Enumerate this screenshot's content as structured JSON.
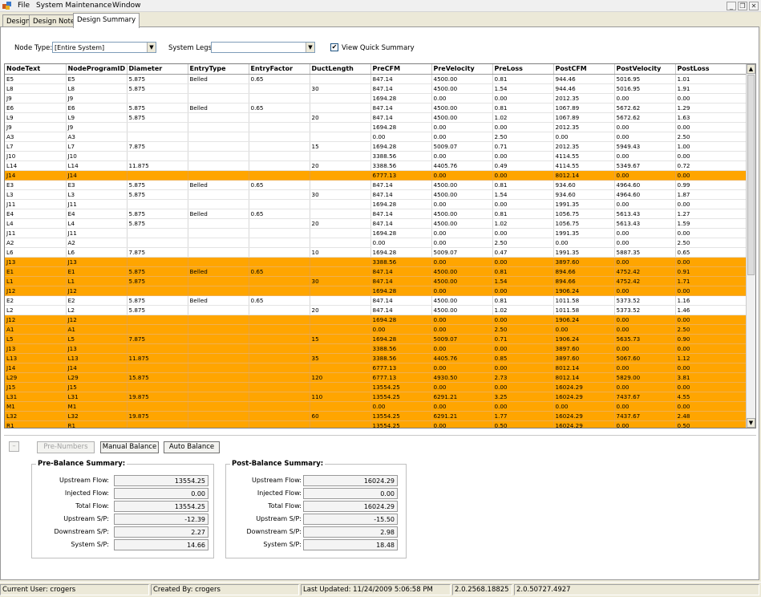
{
  "menu": [
    "File",
    "System Maintenance",
    "Window"
  ],
  "window_controls": [
    "_",
    "❐",
    "✕"
  ],
  "tabs": [
    "Design",
    "Design Notes",
    "Design Summary"
  ],
  "filters": {
    "node_type_label": "Node Type:",
    "node_type_value": "[Entire System]",
    "system_legs_label": "System Legs:",
    "system_legs_value": "",
    "quick_summary_label": "View Quick Summary",
    "quick_summary_checked": true
  },
  "grid": {
    "columns": [
      "NodeText",
      "NodeProgramID",
      "Diameter",
      "EntryType",
      "EntryFactor",
      "DuctLength",
      "PreCFM",
      "PreVelocity",
      "PreLoss",
      "PostCFM",
      "PostVelocity",
      "PostLoss"
    ],
    "highlight_color": "#ffa500",
    "rows": [
      {
        "hl": false,
        "cells": [
          "E5",
          "E5",
          "5.875",
          "Belled",
          "0.65",
          "",
          "847.14",
          "4500.00",
          "0.81",
          "944.46",
          "5016.95",
          "1.01"
        ]
      },
      {
        "hl": false,
        "cells": [
          "L8",
          "L8",
          "5.875",
          "",
          "",
          "30",
          "847.14",
          "4500.00",
          "1.54",
          "944.46",
          "5016.95",
          "1.91"
        ]
      },
      {
        "hl": false,
        "cells": [
          "J9",
          "J9",
          "",
          "",
          "",
          "",
          "1694.28",
          "0.00",
          "0.00",
          "2012.35",
          "0.00",
          "0.00"
        ]
      },
      {
        "hl": false,
        "cells": [
          "E6",
          "E6",
          "5.875",
          "Belled",
          "0.65",
          "",
          "847.14",
          "4500.00",
          "0.81",
          "1067.89",
          "5672.62",
          "1.29"
        ]
      },
      {
        "hl": false,
        "cells": [
          "L9",
          "L9",
          "5.875",
          "",
          "",
          "20",
          "847.14",
          "4500.00",
          "1.02",
          "1067.89",
          "5672.62",
          "1.63"
        ]
      },
      {
        "hl": false,
        "cells": [
          "J9",
          "J9",
          "",
          "",
          "",
          "",
          "1694.28",
          "0.00",
          "0.00",
          "2012.35",
          "0.00",
          "0.00"
        ]
      },
      {
        "hl": false,
        "cells": [
          "A3",
          "A3",
          "",
          "",
          "",
          "",
          "0.00",
          "0.00",
          "2.50",
          "0.00",
          "0.00",
          "2.50"
        ]
      },
      {
        "hl": false,
        "cells": [
          "L7",
          "L7",
          "7.875",
          "",
          "",
          "15",
          "1694.28",
          "5009.07",
          "0.71",
          "2012.35",
          "5949.43",
          "1.00"
        ]
      },
      {
        "hl": false,
        "cells": [
          "J10",
          "J10",
          "",
          "",
          "",
          "",
          "3388.56",
          "0.00",
          "0.00",
          "4114.55",
          "0.00",
          "0.00"
        ]
      },
      {
        "hl": false,
        "cells": [
          "L14",
          "L14",
          "11.875",
          "",
          "",
          "20",
          "3388.56",
          "4405.76",
          "0.49",
          "4114.55",
          "5349.67",
          "0.72"
        ]
      },
      {
        "hl": true,
        "cells": [
          "J14",
          "J14",
          "",
          "",
          "",
          "",
          "6777.13",
          "0.00",
          "0.00",
          "8012.14",
          "0.00",
          "0.00"
        ]
      },
      {
        "hl": false,
        "cells": [
          "E3",
          "E3",
          "5.875",
          "Belled",
          "0.65",
          "",
          "847.14",
          "4500.00",
          "0.81",
          "934.60",
          "4964.60",
          "0.99"
        ]
      },
      {
        "hl": false,
        "cells": [
          "L3",
          "L3",
          "5.875",
          "",
          "",
          "30",
          "847.14",
          "4500.00",
          "1.54",
          "934.60",
          "4964.60",
          "1.87"
        ]
      },
      {
        "hl": false,
        "cells": [
          "J11",
          "J11",
          "",
          "",
          "",
          "",
          "1694.28",
          "0.00",
          "0.00",
          "1991.35",
          "0.00",
          "0.00"
        ]
      },
      {
        "hl": false,
        "cells": [
          "E4",
          "E4",
          "5.875",
          "Belled",
          "0.65",
          "",
          "847.14",
          "4500.00",
          "0.81",
          "1056.75",
          "5613.43",
          "1.27"
        ]
      },
      {
        "hl": false,
        "cells": [
          "L4",
          "L4",
          "5.875",
          "",
          "",
          "20",
          "847.14",
          "4500.00",
          "1.02",
          "1056.75",
          "5613.43",
          "1.59"
        ]
      },
      {
        "hl": false,
        "cells": [
          "J11",
          "J11",
          "",
          "",
          "",
          "",
          "1694.28",
          "0.00",
          "0.00",
          "1991.35",
          "0.00",
          "0.00"
        ]
      },
      {
        "hl": false,
        "cells": [
          "A2",
          "A2",
          "",
          "",
          "",
          "",
          "0.00",
          "0.00",
          "2.50",
          "0.00",
          "0.00",
          "2.50"
        ]
      },
      {
        "hl": false,
        "cells": [
          "L6",
          "L6",
          "7.875",
          "",
          "",
          "10",
          "1694.28",
          "5009.07",
          "0.47",
          "1991.35",
          "5887.35",
          "0.65"
        ]
      },
      {
        "hl": true,
        "cells": [
          "J13",
          "J13",
          "",
          "",
          "",
          "",
          "3388.56",
          "0.00",
          "0.00",
          "3897.60",
          "0.00",
          "0.00"
        ]
      },
      {
        "hl": true,
        "cells": [
          "E1",
          "E1",
          "5.875",
          "Belled",
          "0.65",
          "",
          "847.14",
          "4500.00",
          "0.81",
          "894.66",
          "4752.42",
          "0.91"
        ]
      },
      {
        "hl": true,
        "cells": [
          "L1",
          "L1",
          "5.875",
          "",
          "",
          "30",
          "847.14",
          "4500.00",
          "1.54",
          "894.66",
          "4752.42",
          "1.71"
        ]
      },
      {
        "hl": true,
        "cells": [
          "J12",
          "J12",
          "",
          "",
          "",
          "",
          "1694.28",
          "0.00",
          "0.00",
          "1906.24",
          "0.00",
          "0.00"
        ]
      },
      {
        "hl": false,
        "cells": [
          "E2",
          "E2",
          "5.875",
          "Belled",
          "0.65",
          "",
          "847.14",
          "4500.00",
          "0.81",
          "1011.58",
          "5373.52",
          "1.16"
        ]
      },
      {
        "hl": false,
        "cells": [
          "L2",
          "L2",
          "5.875",
          "",
          "",
          "20",
          "847.14",
          "4500.00",
          "1.02",
          "1011.58",
          "5373.52",
          "1.46"
        ]
      },
      {
        "hl": true,
        "cells": [
          "J12",
          "J12",
          "",
          "",
          "",
          "",
          "1694.28",
          "0.00",
          "0.00",
          "1906.24",
          "0.00",
          "0.00"
        ]
      },
      {
        "hl": true,
        "cells": [
          "A1",
          "A1",
          "",
          "",
          "",
          "",
          "0.00",
          "0.00",
          "2.50",
          "0.00",
          "0.00",
          "2.50"
        ]
      },
      {
        "hl": true,
        "cells": [
          "L5",
          "L5",
          "7.875",
          "",
          "",
          "15",
          "1694.28",
          "5009.07",
          "0.71",
          "1906.24",
          "5635.73",
          "0.90"
        ]
      },
      {
        "hl": true,
        "cells": [
          "J13",
          "J13",
          "",
          "",
          "",
          "",
          "3388.56",
          "0.00",
          "0.00",
          "3897.60",
          "0.00",
          "0.00"
        ]
      },
      {
        "hl": true,
        "cells": [
          "L13",
          "L13",
          "11.875",
          "",
          "",
          "35",
          "3388.56",
          "4405.76",
          "0.85",
          "3897.60",
          "5067.60",
          "1.12"
        ]
      },
      {
        "hl": true,
        "cells": [
          "J14",
          "J14",
          "",
          "",
          "",
          "",
          "6777.13",
          "0.00",
          "0.00",
          "8012.14",
          "0.00",
          "0.00"
        ]
      },
      {
        "hl": true,
        "cells": [
          "L29",
          "L29",
          "15.875",
          "",
          "",
          "120",
          "6777.13",
          "4930.50",
          "2.73",
          "8012.14",
          "5829.00",
          "3.81"
        ]
      },
      {
        "hl": true,
        "cells": [
          "J15",
          "J15",
          "",
          "",
          "",
          "",
          "13554.25",
          "0.00",
          "0.00",
          "16024.29",
          "0.00",
          "0.00"
        ]
      },
      {
        "hl": true,
        "cells": [
          "L31",
          "L31",
          "19.875",
          "",
          "",
          "110",
          "13554.25",
          "6291.21",
          "3.25",
          "16024.29",
          "7437.67",
          "4.55"
        ]
      },
      {
        "hl": true,
        "cells": [
          "M1",
          "M1",
          "",
          "",
          "",
          "",
          "0.00",
          "0.00",
          "0.00",
          "0.00",
          "0.00",
          "0.00"
        ]
      },
      {
        "hl": true,
        "cells": [
          "L32",
          "L32",
          "19.875",
          "",
          "",
          "60",
          "13554.25",
          "6291.21",
          "1.77",
          "16024.29",
          "7437.67",
          "2.48"
        ]
      },
      {
        "hl": true,
        "cells": [
          "R1",
          "R1",
          "",
          "",
          "",
          "",
          "13554.25",
          "0.00",
          "0.50",
          "16024.29",
          "0.00",
          "0.50"
        ]
      }
    ]
  },
  "actions": {
    "collapse_glyph": "–",
    "pre_numbers": "Pre-Numbers",
    "manual_balance": "Manual Balance",
    "auto_balance": "Auto Balance"
  },
  "pre_balance": {
    "title": "Pre-Balance Summary:",
    "rows": [
      {
        "label": "Upstream Flow:",
        "value": "13554.25"
      },
      {
        "label": "Injected Flow:",
        "value": "0.00"
      },
      {
        "label": "Total Flow:",
        "value": "13554.25"
      },
      {
        "label": "Upstream S/P:",
        "value": "-12.39"
      },
      {
        "label": "Downstream S/P:",
        "value": "2.27"
      },
      {
        "label": "System S/P:",
        "value": "14.66"
      }
    ]
  },
  "post_balance": {
    "title": "Post-Balance Summary:",
    "rows": [
      {
        "label": "Upstream Flow:",
        "value": "16024.29"
      },
      {
        "label": "Injected Flow:",
        "value": "0.00"
      },
      {
        "label": "Total Flow:",
        "value": "16024.29"
      },
      {
        "label": "Upstream S/P:",
        "value": "-15.50"
      },
      {
        "label": "Downstream S/P:",
        "value": "2.98"
      },
      {
        "label": "System S/P:",
        "value": "18.48"
      }
    ]
  },
  "status": {
    "current_user": "Current User: crogers",
    "created_by": "Created By: crogers",
    "last_updated": "Last Updated: 11/24/2009 5:06:58 PM",
    "version": "2.0.2568.18825",
    "runtime": "2.0.50727.4927"
  }
}
